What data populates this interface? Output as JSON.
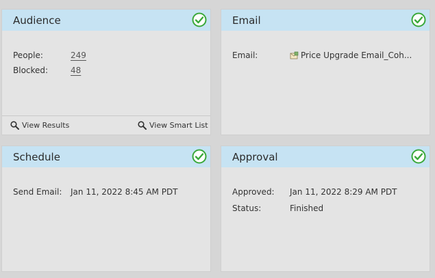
{
  "audience": {
    "title": "Audience",
    "people_label": "People:",
    "people_value": "249",
    "blocked_label": "Blocked:",
    "blocked_value": "48",
    "view_results": "View Results",
    "view_smart_list": "View Smart List"
  },
  "email": {
    "title": "Email",
    "email_label": "Email:",
    "email_value": "Price Upgrade Email_Coh..."
  },
  "schedule": {
    "title": "Schedule",
    "send_label": "Send Email:",
    "send_value": "Jan 11, 2022 8:45 AM PDT"
  },
  "approval": {
    "title": "Approval",
    "approved_label": "Approved:",
    "approved_value": "Jan 11, 2022 8:29 AM PDT",
    "status_label": "Status:",
    "status_value": "Finished"
  },
  "colors": {
    "header_bg": "#c6e3f3",
    "card_bg": "#e4e4e4",
    "check_green": "#3aa83a"
  },
  "icons": [
    "check-circle-icon",
    "search-icon",
    "email-document-icon"
  ]
}
